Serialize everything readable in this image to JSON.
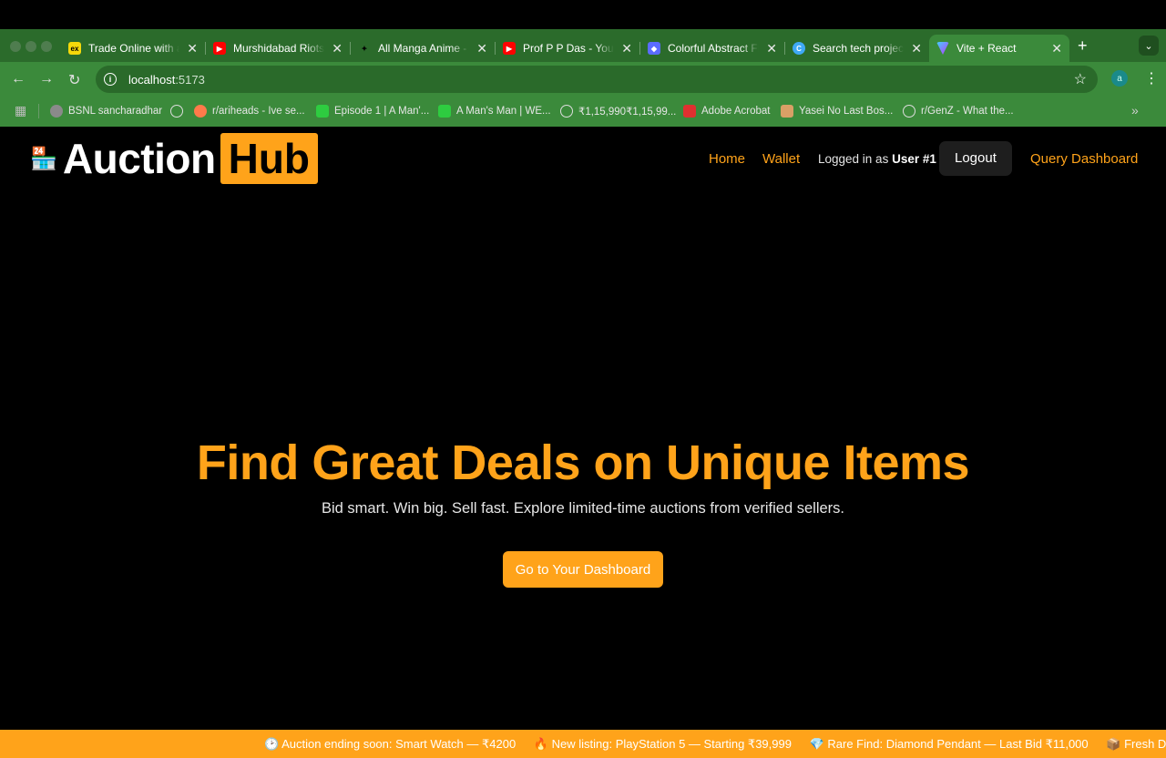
{
  "browser": {
    "tabs": [
      {
        "title": "Trade Online with a",
        "icon": "exness-icon",
        "color": "#f5d90a"
      },
      {
        "title": "Murshidabad Riots,",
        "icon": "youtube-icon",
        "color": "#ff0000"
      },
      {
        "title": "All Manga Anime - A",
        "icon": "manga-icon",
        "color": "#222222"
      },
      {
        "title": "Prof P P Das - YouTu",
        "icon": "youtube-icon",
        "color": "#ff0000"
      },
      {
        "title": "Colorful Abstract Fi",
        "icon": "abstract-icon",
        "color": "#5b6cff"
      },
      {
        "title": "Search tech project",
        "icon": "search-icon",
        "color": "#3fa9f5"
      },
      {
        "title": "Vite + React",
        "icon": "vite-icon",
        "color": "#a855f7"
      }
    ],
    "new_tab": "+",
    "url_host": "localhost",
    "url_port": ":5173",
    "profile_initial": "a",
    "bookmarks": [
      {
        "label": "BSNL sancharadhar",
        "icon": "bsnl-icon",
        "color": "#8a8a8a"
      },
      {
        "label": "r/ariheads - Ive se...",
        "icon": "reddit-icon",
        "color": "#ff7a4a"
      },
      {
        "label": "Episode 1 | A Man'...",
        "icon": "leaf-icon",
        "color": "#2ecc40"
      },
      {
        "label": "A Man's Man | WE...",
        "icon": "leaf-icon",
        "color": "#2ecc40"
      },
      {
        "label": "₹1,15,990₹1,15,99...",
        "icon": "globe-icon",
        "color": "#cccccc"
      },
      {
        "label": "Adobe Acrobat",
        "icon": "acrobat-icon",
        "color": "#e03030"
      },
      {
        "label": "Yasei No Last Bos...",
        "icon": "manga-icon",
        "color": "#d9a066"
      },
      {
        "label": "r/GenZ - What the...",
        "icon": "globe-icon",
        "color": "#cccccc"
      }
    ]
  },
  "app": {
    "logo_emoji": "🏪",
    "logo_word1": "Auction",
    "logo_word2": "Hub",
    "nav": {
      "home": "Home",
      "wallet": "Wallet",
      "logged_prefix": "Logged in as",
      "logged_user": "User #1",
      "logout": "Logout",
      "query_dashboard": "Query Dashboard"
    },
    "hero": {
      "title": "Find Great Deals on Unique Items",
      "subtitle": "Bid smart. Win big. Sell fast. Explore limited-time auctions from verified sellers.",
      "cta": "Go to Your Dashboard"
    },
    "ticker": [
      "🕑 Auction ending soon: Smart Watch — ₹4200",
      "🔥 New listing: PlayStation 5 — Starting ₹39,999",
      "💎 Rare Find: Diamond Pendant — Last Bid ₹11,000",
      "📦 Fresh Drop: Wir"
    ],
    "accent_color": "#ffa31a"
  }
}
